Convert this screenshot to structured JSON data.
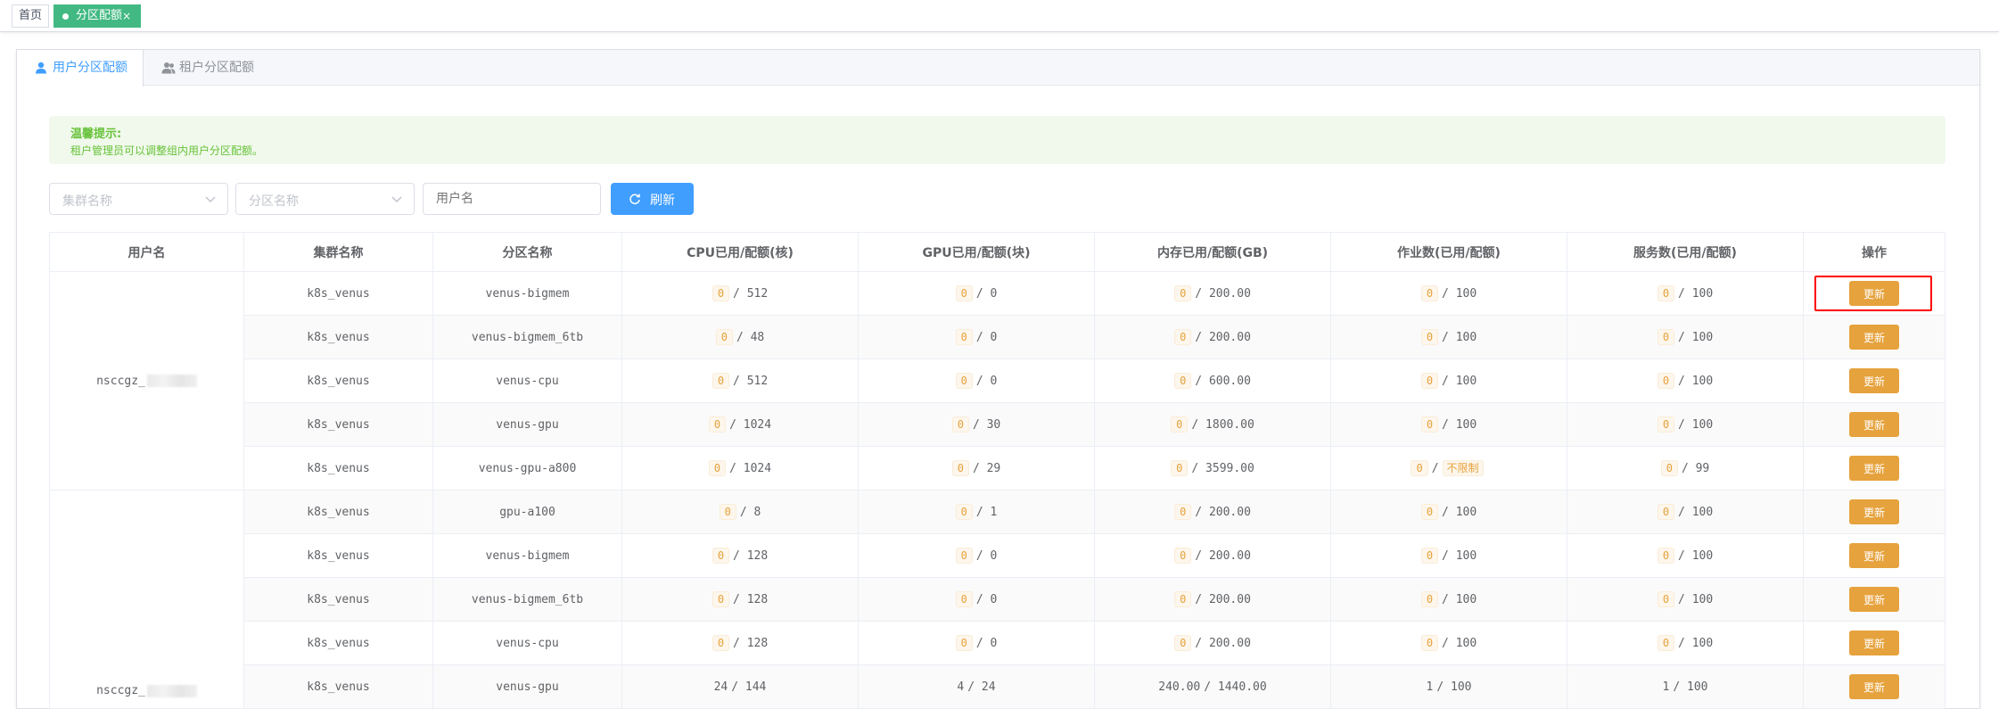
{
  "tags": {
    "home": "首页",
    "active": "分区配额",
    "close": "×"
  },
  "tabs": [
    {
      "label": "用户分区配额"
    },
    {
      "label": "租户分区配额"
    }
  ],
  "alert": {
    "title": "温馨提示:",
    "text": "租户管理员可以调整组内用户分区配额。"
  },
  "filters": {
    "cluster_placeholder": "集群名称",
    "partition_placeholder": "分区名称",
    "user_placeholder": "用户名",
    "refresh_label": "刷新"
  },
  "table": {
    "headers": [
      "用户名",
      "集群名称",
      "分区名称",
      "CPU已用/配额(核)",
      "GPU已用/配额(块)",
      "内存已用/配额(GB)",
      "作业数(已用/配额)",
      "服务数(已用/配额)",
      "操作"
    ],
    "action_label": "更新",
    "users": [
      "nsccgz_",
      "nsccgz_"
    ],
    "rows": [
      {
        "cluster": "k8s_venus",
        "partition": "venus-bigmem",
        "cpu": [
          "0",
          "/ 512"
        ],
        "gpu": [
          "0",
          "/ 0"
        ],
        "mem": [
          "0",
          "/ 200.00"
        ],
        "jobs": [
          "0",
          "/ 100"
        ],
        "svc": [
          "0",
          "/ 100"
        ]
      },
      {
        "cluster": "k8s_venus",
        "partition": "venus-bigmem_6tb",
        "cpu": [
          "0",
          "/ 48"
        ],
        "gpu": [
          "0",
          "/ 0"
        ],
        "mem": [
          "0",
          "/ 200.00"
        ],
        "jobs": [
          "0",
          "/ 100"
        ],
        "svc": [
          "0",
          "/ 100"
        ]
      },
      {
        "cluster": "k8s_venus",
        "partition": "venus-cpu",
        "cpu": [
          "0",
          "/ 512"
        ],
        "gpu": [
          "0",
          "/ 0"
        ],
        "mem": [
          "0",
          "/ 600.00"
        ],
        "jobs": [
          "0",
          "/ 100"
        ],
        "svc": [
          "0",
          "/ 100"
        ]
      },
      {
        "cluster": "k8s_venus",
        "partition": "venus-gpu",
        "cpu": [
          "0",
          "/ 1024"
        ],
        "gpu": [
          "0",
          "/ 30"
        ],
        "mem": [
          "0",
          "/ 1800.00"
        ],
        "jobs": [
          "0",
          "/ 100"
        ],
        "svc": [
          "0",
          "/ 100"
        ]
      },
      {
        "cluster": "k8s_venus",
        "partition": "venus-gpu-a800",
        "cpu": [
          "0",
          "/ 1024"
        ],
        "gpu": [
          "0",
          "/ 29"
        ],
        "mem": [
          "0",
          "/ 3599.00"
        ],
        "jobs": [
          "0",
          "/",
          "不限制"
        ],
        "svc": [
          "0",
          "/ 99"
        ]
      },
      {
        "cluster": "k8s_venus",
        "partition": "gpu-a100",
        "cpu": [
          "0",
          "/ 8"
        ],
        "gpu": [
          "0",
          "/ 1"
        ],
        "mem": [
          "0",
          "/ 200.00"
        ],
        "jobs": [
          "0",
          "/ 100"
        ],
        "svc": [
          "0",
          "/ 100"
        ]
      },
      {
        "cluster": "k8s_venus",
        "partition": "venus-bigmem",
        "cpu": [
          "0",
          "/ 128"
        ],
        "gpu": [
          "0",
          "/ 0"
        ],
        "mem": [
          "0",
          "/ 200.00"
        ],
        "jobs": [
          "0",
          "/ 100"
        ],
        "svc": [
          "0",
          "/ 100"
        ]
      },
      {
        "cluster": "k8s_venus",
        "partition": "venus-bigmem_6tb",
        "cpu": [
          "0",
          "/ 128"
        ],
        "gpu": [
          "0",
          "/ 0"
        ],
        "mem": [
          "0",
          "/ 200.00"
        ],
        "jobs": [
          "0",
          "/ 100"
        ],
        "svc": [
          "0",
          "/ 100"
        ]
      },
      {
        "cluster": "k8s_venus",
        "partition": "venus-cpu",
        "cpu": [
          "0",
          "/ 128"
        ],
        "gpu": [
          "0",
          "/ 0"
        ],
        "mem": [
          "0",
          "/ 200.00"
        ],
        "jobs": [
          "0",
          "/ 100"
        ],
        "svc": [
          "0",
          "/ 100"
        ]
      },
      {
        "cluster": "k8s_venus",
        "partition": "venus-gpu",
        "cpu": [
          "24",
          "/ 144"
        ],
        "gpu": [
          "4",
          "/ 24"
        ],
        "mem": [
          "240.00",
          "/ 1440.00"
        ],
        "jobs": [
          "1",
          "/ 100"
        ],
        "svc": [
          "1",
          "/ 100"
        ]
      }
    ]
  },
  "colors": {
    "primary": "#409eff",
    "warning": "#e6a23c",
    "success": "#42b983",
    "highlight": "#ff0000"
  }
}
